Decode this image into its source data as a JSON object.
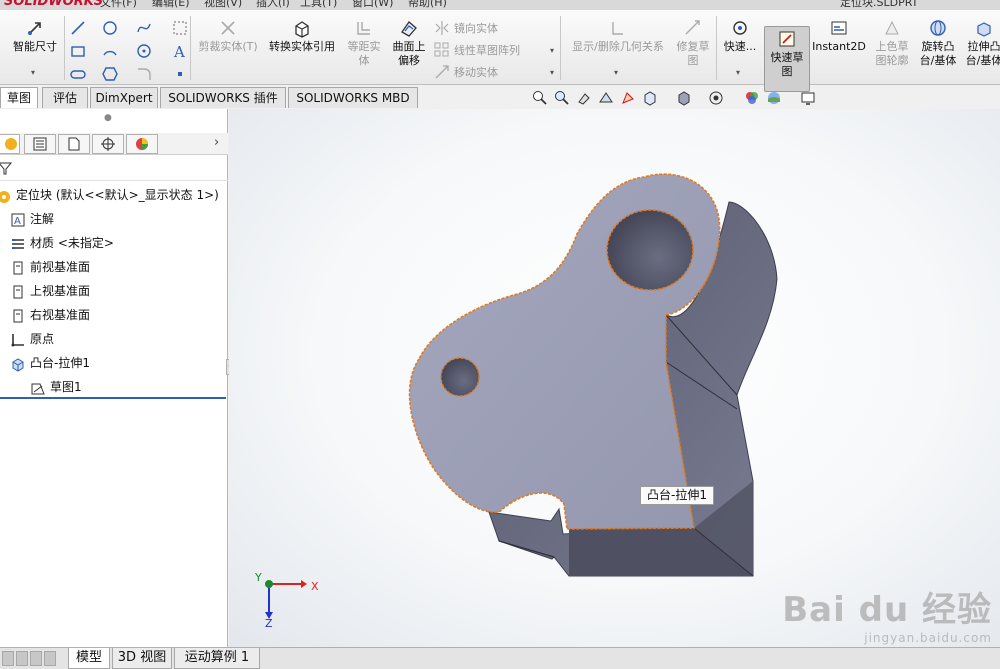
{
  "app": {
    "logo": "SOLIDWORKS",
    "document_title": "定位块.SLDPRT"
  },
  "menu": [
    "文件(F)",
    "编辑(E)",
    "视图(V)",
    "插入(I)",
    "工具(T)",
    "窗口(W)",
    "帮助(H)"
  ],
  "ribbon": {
    "smart_dimension": "智能尺寸",
    "trim_entities": "剪裁实体(T)",
    "convert_entities": "转换实体引用",
    "offset_entities_line1": "等距实",
    "offset_entities_line2": "体",
    "offset_on_surface_line1": "曲面上",
    "offset_on_surface_line2": "偏移",
    "mirror_entities": "镜向实体",
    "linear_pattern": "线性草图阵列",
    "move_entities": "移动实体",
    "display_delete_relations": "显示/删除几何关系",
    "repair_sketch_line1": "修复草",
    "repair_sketch_line2": "图",
    "quick_snaps": "快速...",
    "rapid_sketch_line1": "快速草",
    "rapid_sketch_line2": "图",
    "instant2d": "Instant2D",
    "shaded_sketch_line1": "上色草",
    "shaded_sketch_line2": "图轮廓",
    "revolved_boss_line1": "旋转凸",
    "revolved_boss_line2": "台/基体",
    "extruded_boss_line1": "拉伸凸",
    "extruded_boss_line2": "台/基体"
  },
  "tabs": [
    "草图",
    "评估",
    "DimXpert",
    "SOLIDWORKS 插件",
    "SOLIDWORKS MBD"
  ],
  "feature_tree": {
    "root": "定位块 (默认<<默认>_显示状态 1>)",
    "items": [
      {
        "label": "注解",
        "icon": "annotations-icon"
      },
      {
        "label": "材质 <未指定>",
        "icon": "material-icon"
      },
      {
        "label": "前视基准面",
        "icon": "plane-icon"
      },
      {
        "label": "上视基准面",
        "icon": "plane-icon"
      },
      {
        "label": "右视基准面",
        "icon": "plane-icon"
      },
      {
        "label": "原点",
        "icon": "origin-icon"
      },
      {
        "label": "凸台-拉伸1",
        "icon": "extrude-icon"
      },
      {
        "label": "草图1",
        "icon": "sketch-icon"
      }
    ]
  },
  "viewport": {
    "tooltip": "凸台-拉伸1",
    "triad": {
      "x": "X",
      "y": "Y",
      "z": "Z"
    },
    "watermark": {
      "main": "Bai du 经验",
      "sub": "jingyan.baidu.com"
    }
  },
  "bottom_tabs": [
    "模型",
    "3D 视图",
    "运动算例 1"
  ],
  "colors": {
    "part_face": "#9ea1b8",
    "part_side": "#6d6f86",
    "edge_highlight": "#e07a1f",
    "accent": "#2f5fb3"
  }
}
